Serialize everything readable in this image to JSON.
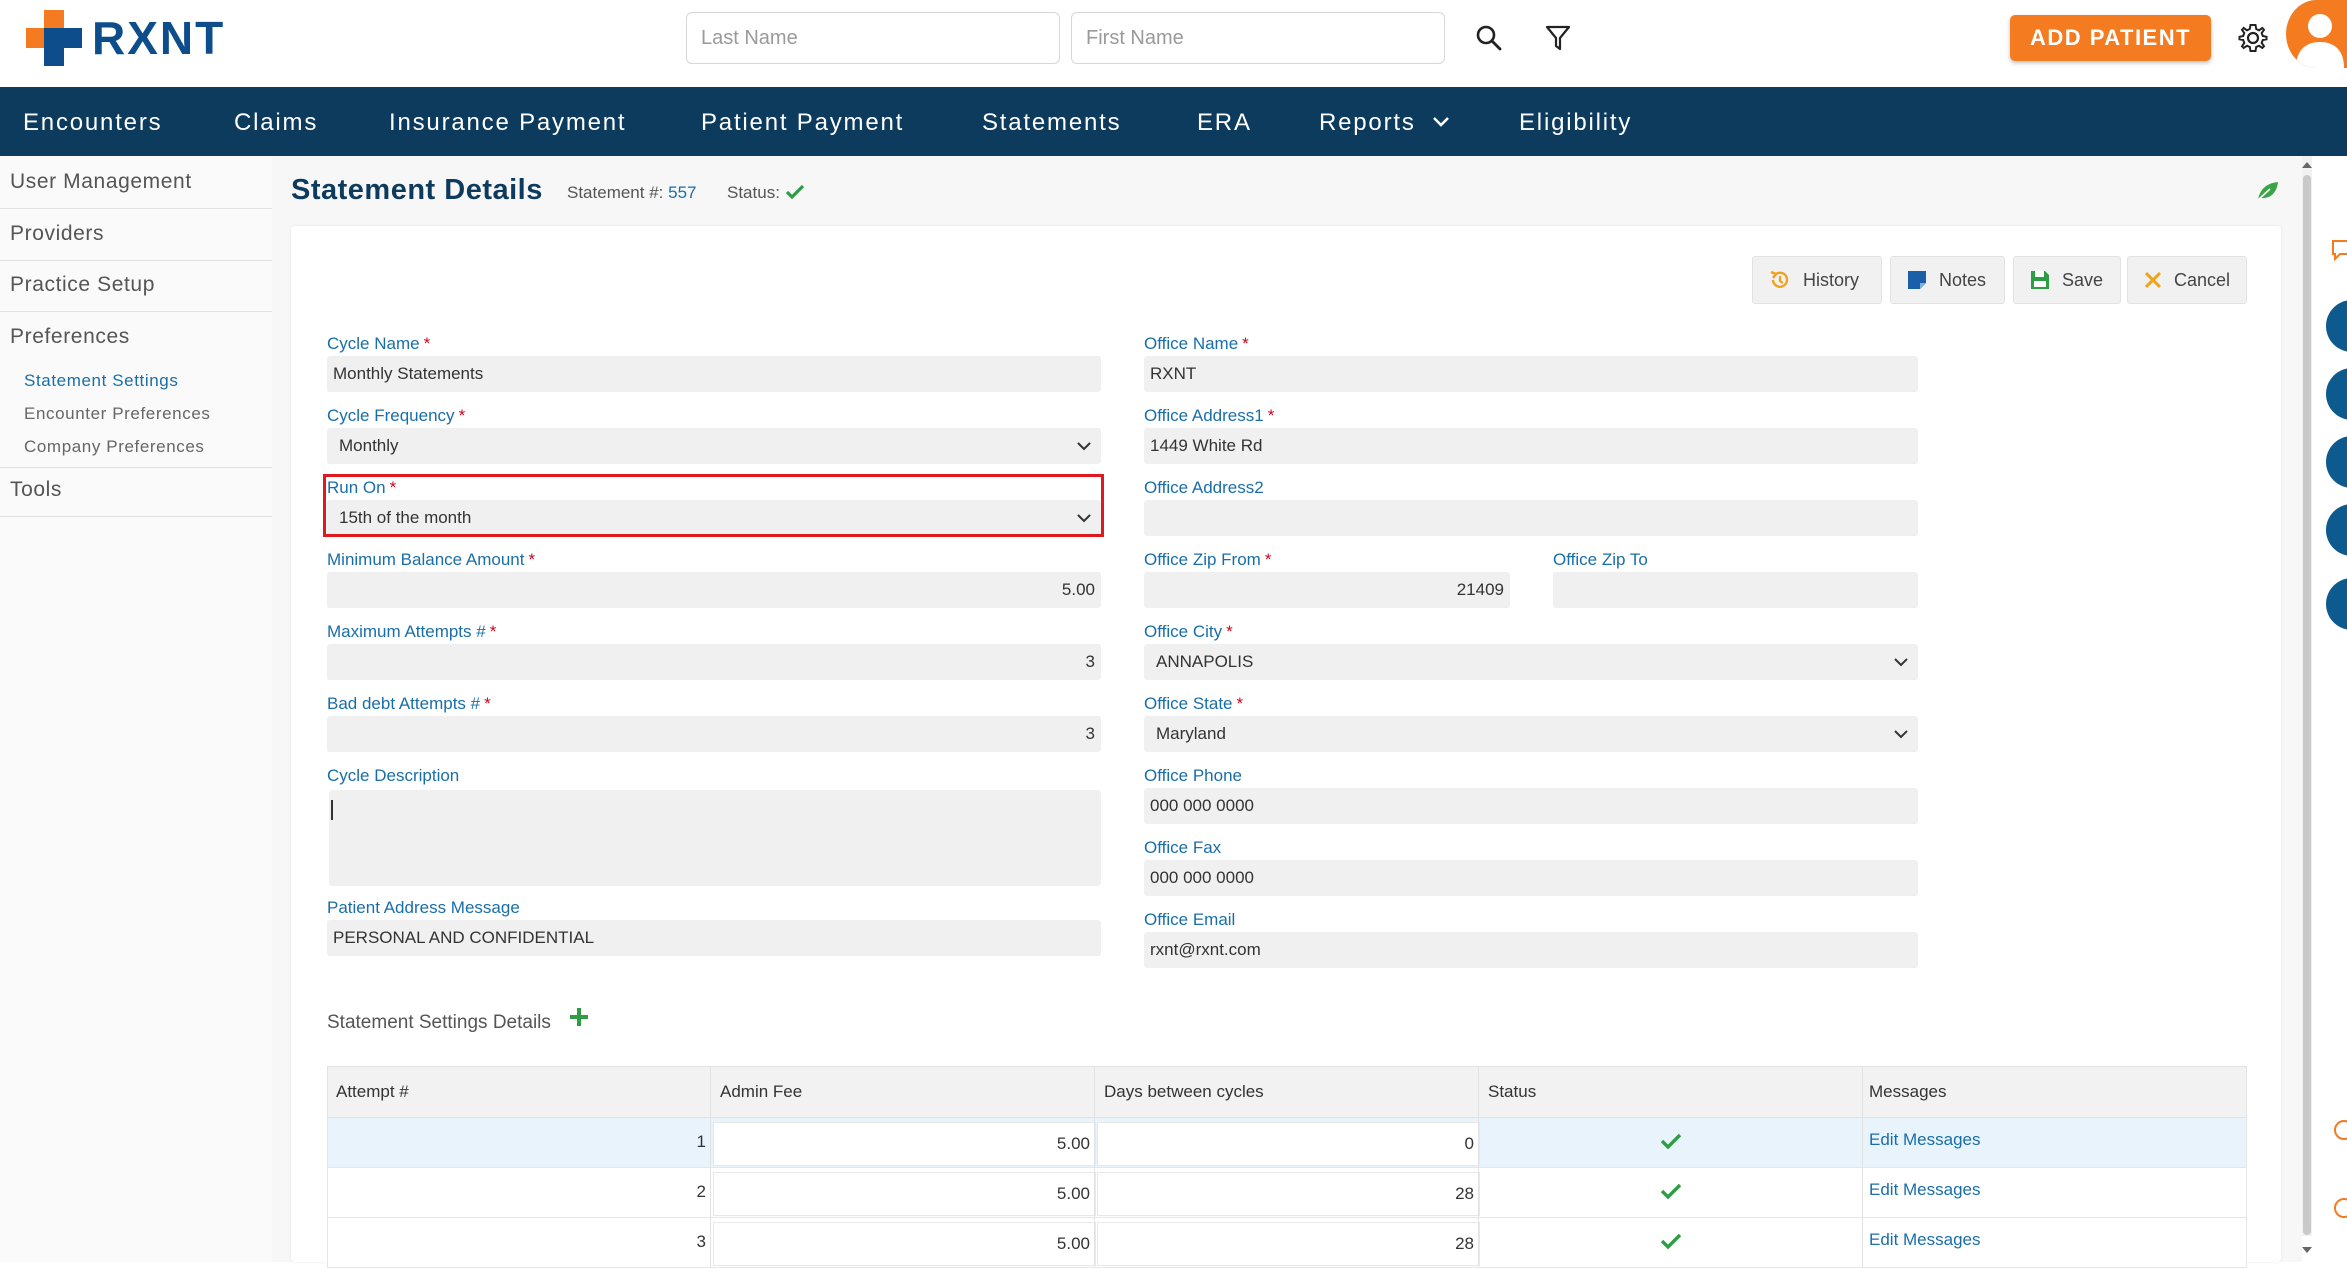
{
  "app": {
    "brand": "RXNT",
    "search": {
      "last_name_placeholder": "Last Name",
      "first_name_placeholder": "First Name"
    },
    "add_patient_label": "ADD PATIENT",
    "colors": {
      "nav": "#0d3b5e",
      "accent": "#f47b20",
      "link": "#1a6ea8",
      "required": "#d0021b"
    }
  },
  "nav": {
    "items": [
      "Encounters",
      "Claims",
      "Insurance Payment",
      "Patient Payment",
      "Statements",
      "ERA",
      "Reports",
      "Eligibility"
    ]
  },
  "sidebar": {
    "items": [
      "User Management",
      "Providers",
      "Practice Setup",
      "Preferences",
      "Tools"
    ],
    "sub_items": [
      "Statement Settings",
      "Encounter Preferences",
      "Company Preferences"
    ]
  },
  "page": {
    "title": "Statement Details",
    "statement_label": "Statement #:",
    "statement_number": "557",
    "status_label": "Status:"
  },
  "toolbar": {
    "history": "History",
    "notes": "Notes",
    "save": "Save",
    "cancel": "Cancel"
  },
  "form": {
    "cycle_name_label": "Cycle Name",
    "cycle_name": "Monthly Statements",
    "cycle_frequency_label": "Cycle Frequency",
    "cycle_frequency": "Monthly",
    "run_on_label": "Run On",
    "run_on": "15th of the month",
    "min_balance_label": "Minimum Balance Amount",
    "min_balance": "5.00",
    "max_attempts_label": "Maximum Attempts #",
    "max_attempts": "3",
    "bad_debt_label": "Bad debt Attempts #",
    "bad_debt": "3",
    "cycle_description_label": "Cycle Description",
    "patient_address_msg_label": "Patient Address Message",
    "patient_address_msg": "PERSONAL AND CONFIDENTIAL",
    "office_name_label": "Office Name",
    "office_name": "RXNT",
    "office_address1_label": "Office Address1",
    "office_address1": "1449 White Rd",
    "office_address2_label": "Office Address2",
    "office_zip_from_label": "Office Zip From",
    "office_zip_from": "21409",
    "office_zip_to_label": "Office Zip To",
    "office_city_label": "Office City",
    "office_city": "ANNAPOLIS",
    "office_state_label": "Office State",
    "office_state": "Maryland",
    "office_phone_label": "Office Phone",
    "office_phone": "000 000 0000",
    "office_fax_label": "Office Fax",
    "office_fax": "000 000 0000",
    "office_email_label": "Office Email",
    "office_email": "rxnt@rxnt.com",
    "required_mark": "*"
  },
  "details": {
    "title": "Statement Settings Details",
    "columns": [
      "Attempt #",
      "Admin Fee",
      "Days between cycles",
      "Status",
      "Messages"
    ],
    "rows": [
      {
        "attempt": "1",
        "fee": "5.00",
        "days": "0",
        "link": "Edit Messages"
      },
      {
        "attempt": "2",
        "fee": "5.00",
        "days": "28",
        "link": "Edit Messages"
      },
      {
        "attempt": "3",
        "fee": "5.00",
        "days": "28",
        "link": "Edit Messages"
      }
    ]
  }
}
